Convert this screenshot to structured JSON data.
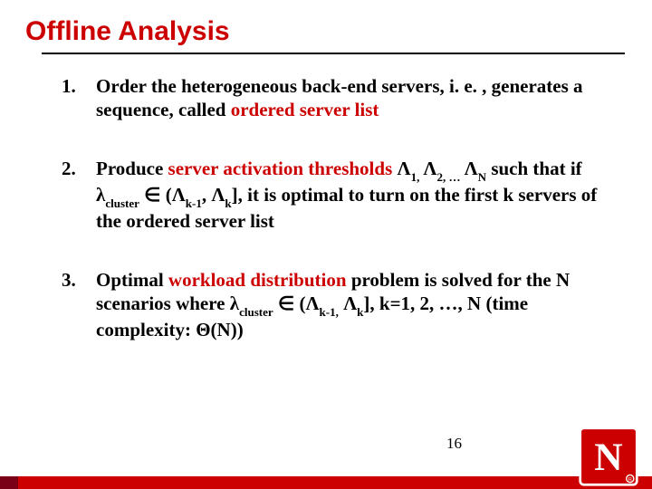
{
  "title": "Offline Analysis",
  "items": [
    {
      "pre": "Order the heterogeneous back-end servers, i. e. , generates a sequence, called ",
      "red": "ordered server list",
      "post": ""
    },
    {
      "html": "Produce <span class=\"red\">server activation thresholds</span> Λ<span class=\"sub\">1,</span> Λ<span class=\"sub\">2, …</span> Λ<span class=\"sub\">N</span> such that if λ<span class=\"sub\">cluster</span> ∈ (Λ<span class=\"sub\">k-1</span>, Λ<span class=\"sub\">k</span>], it is optimal to turn on the first k servers of the ordered server list"
    },
    {
      "html": "Optimal <span class=\"red\">workload distribution</span> problem is solved for the N scenarios where λ<span class=\"sub\">cluster</span> ∈ (Λ<span class=\"sub\">k-1,</span> Λ<span class=\"sub\">k</span>], k=1, 2, …, N (time complexity: Θ(N))"
    }
  ],
  "page_number": "16",
  "logo_letter": "N"
}
